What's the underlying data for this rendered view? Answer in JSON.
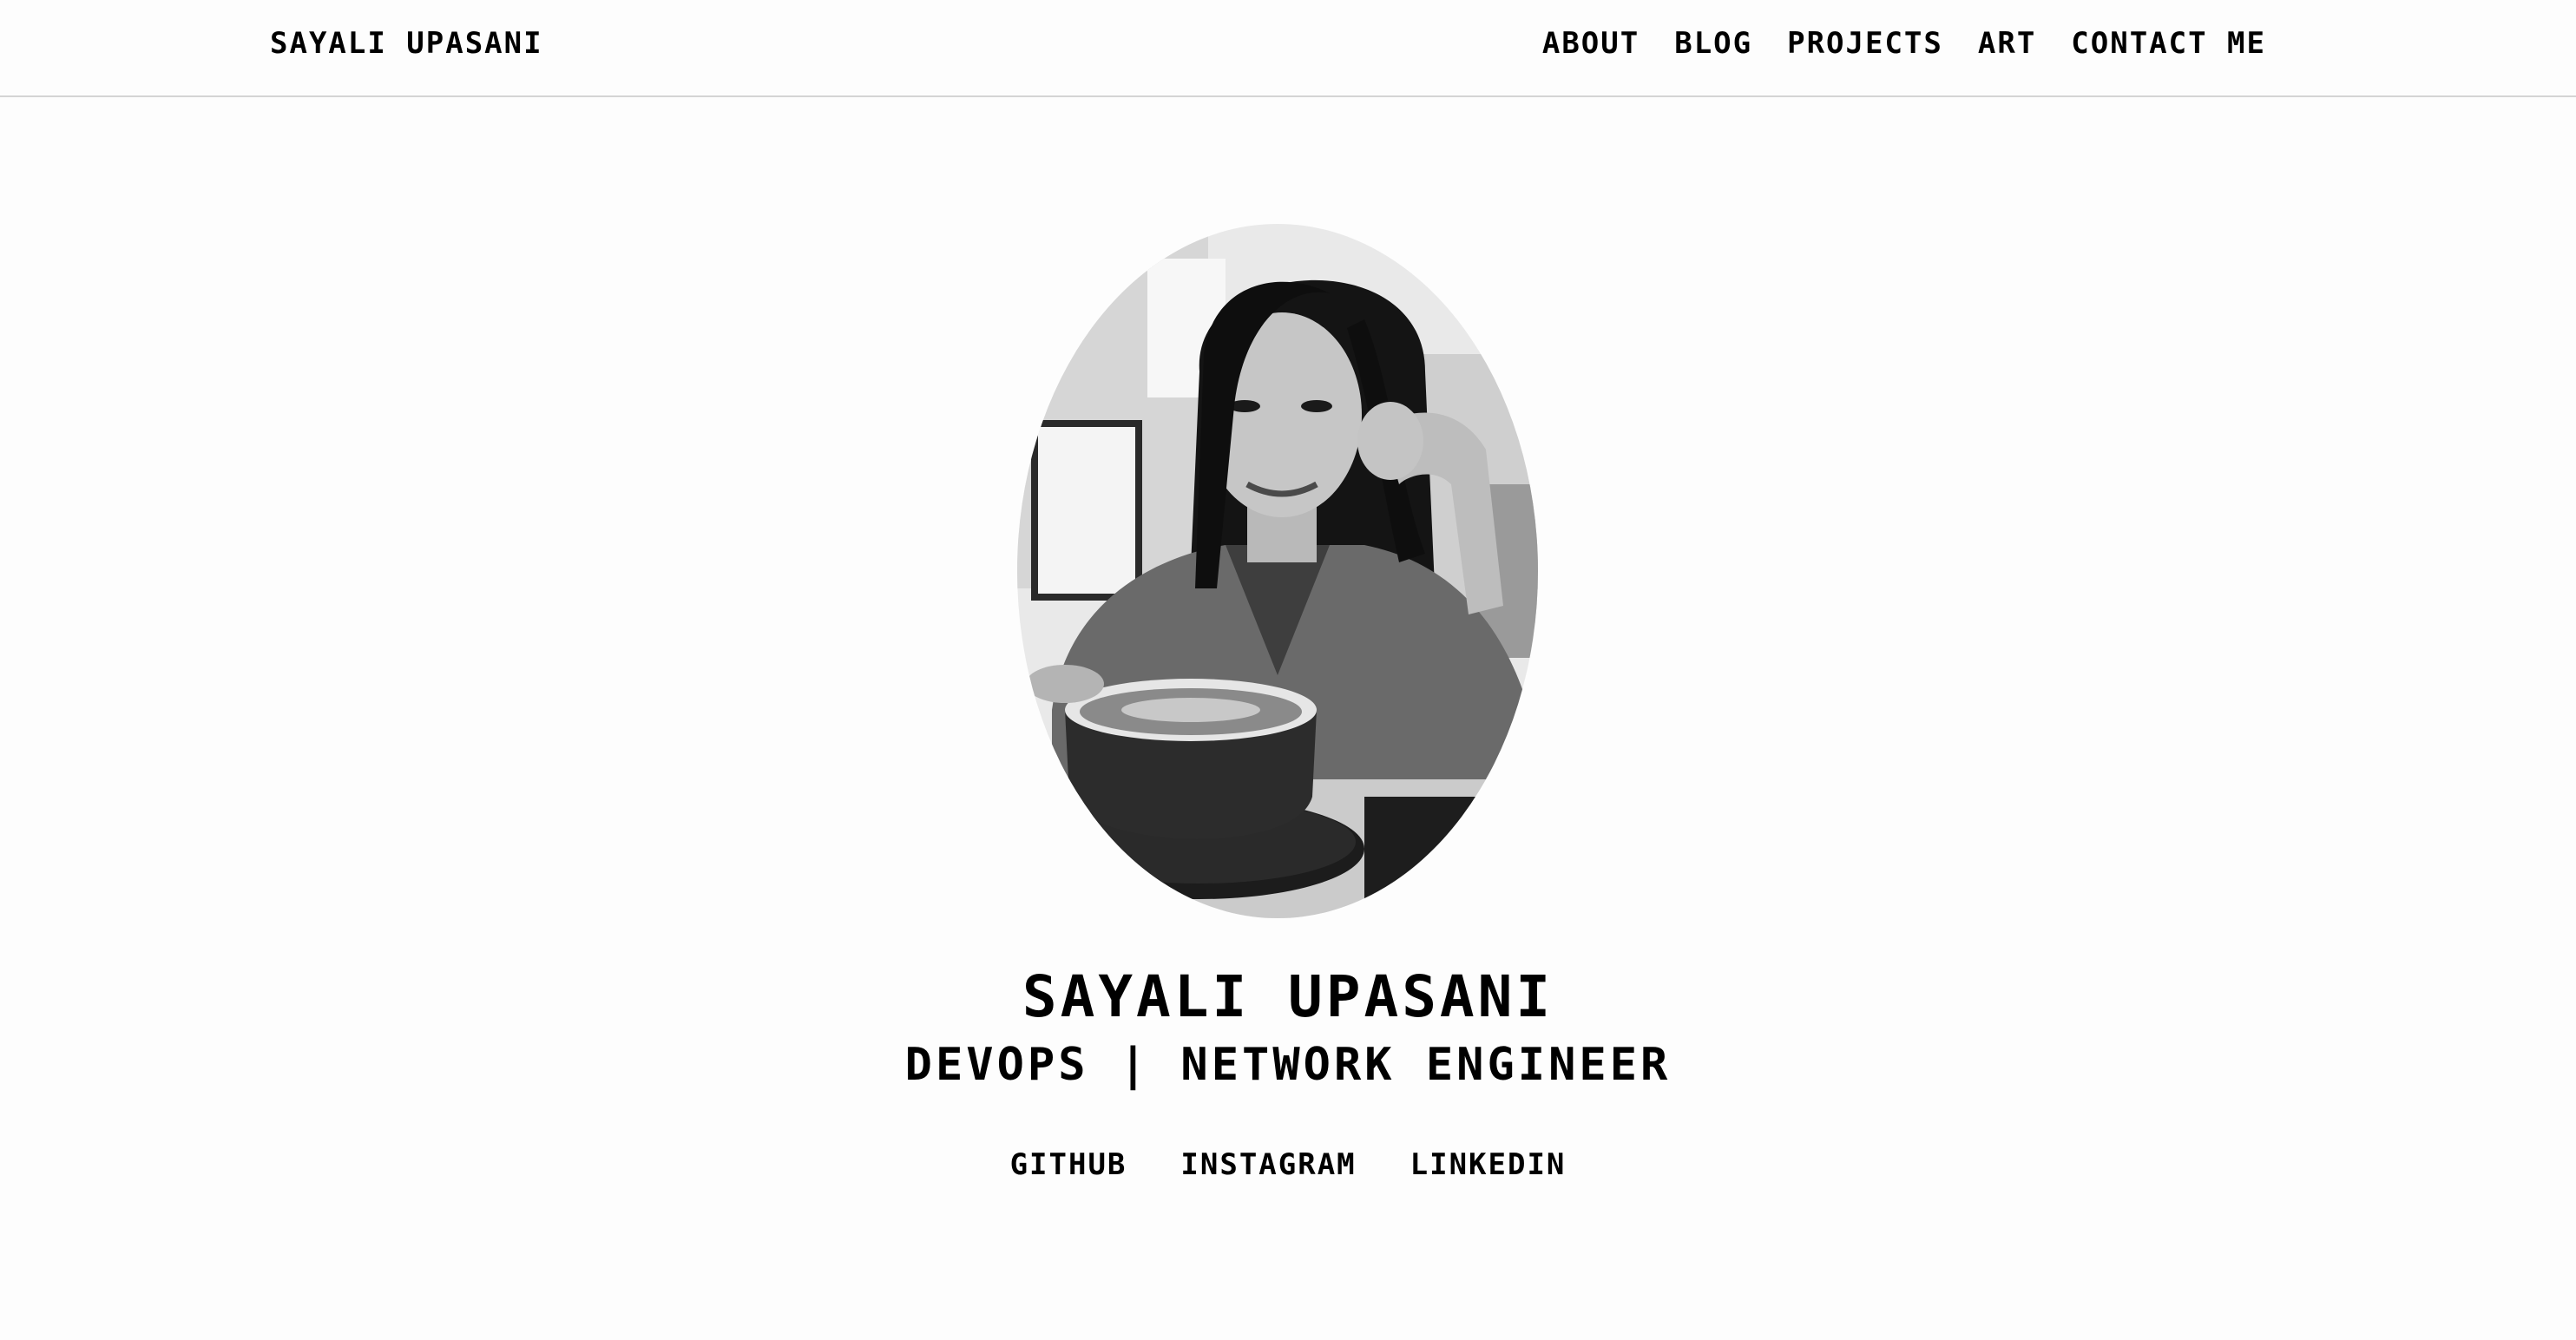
{
  "header": {
    "brand": "SAYALI UPASANI",
    "nav": [
      "ABOUT",
      "BLOG",
      "PROJECTS",
      "ART",
      "CONTACT ME"
    ]
  },
  "hero": {
    "name": "SAYALI UPASANI",
    "role": "DEVOPS | NETWORK ENGINEER",
    "portrait_icon": "profile-photo-bw",
    "socials": [
      "GITHUB",
      "INSTAGRAM",
      "LINKEDIN"
    ]
  },
  "colors": {
    "background": "#fdfdfd",
    "text": "#000000",
    "divider": "#d4d4d4"
  }
}
